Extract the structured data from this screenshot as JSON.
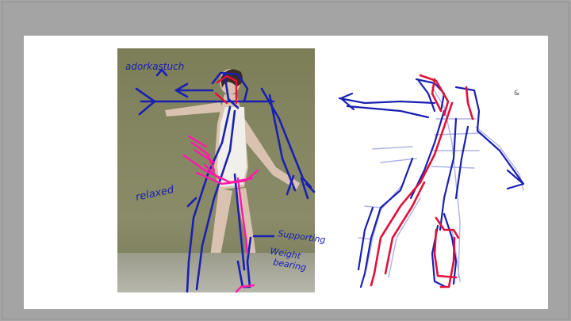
{
  "annotations": {
    "top_label": "adorkastuch",
    "left_label": "relaxed",
    "right_label_1": "Supporting",
    "right_label_2": "Weight",
    "right_label_3": "bearing",
    "corner_mark": "&"
  },
  "colors": {
    "outer_bg": "#a6a6a6",
    "slide_bg": "#ffffff",
    "ink_blue": "#1a20b0",
    "ink_red": "#e0123a",
    "ink_magenta": "#ff1aa8",
    "ink_lavender": "#9b9fe0"
  }
}
